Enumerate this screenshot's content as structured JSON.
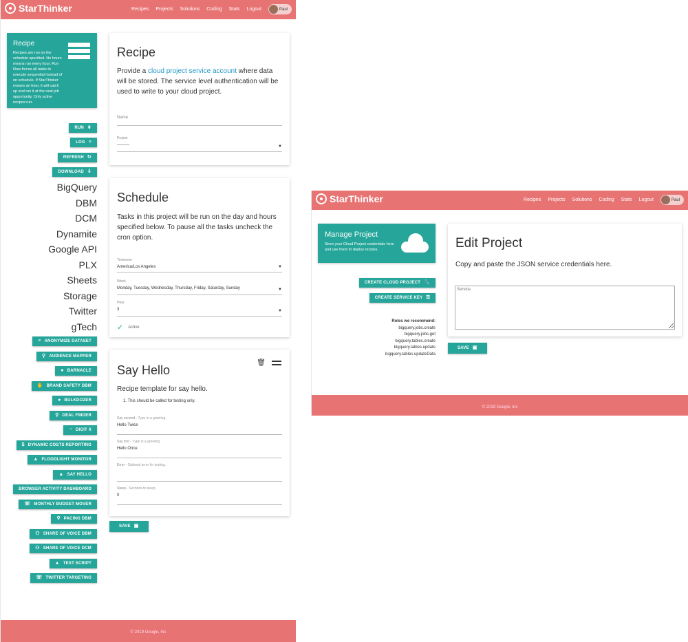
{
  "brand": "StarThinker",
  "nav": [
    "Recipes",
    "Projects",
    "Solutions",
    "Coding",
    "Stats",
    "Logout"
  ],
  "user": "Paul",
  "footer": "© 2019 Google, Inc",
  "recipe_page": {
    "info": {
      "title": "Recipe",
      "text": "Recipes are run on the schedule specified. No hours means run every hour. Run Now forces all tasks to execute sequential instead of on schedule. If StarThinker misses an hour, it will catch up and run it at the next job opportunity. Only active recipes run."
    },
    "actions": [
      {
        "label": "RUN",
        "icon": "⇟",
        "name": "run-button"
      },
      {
        "label": "LOG",
        "icon": "≡",
        "name": "log-button"
      },
      {
        "label": "REFRESH",
        "icon": "↻",
        "name": "refresh-button"
      },
      {
        "label": "DOWNLOAD",
        "icon": "⇩",
        "name": "download-button"
      }
    ],
    "sections": [
      "BigQuery",
      "DBM",
      "DCM",
      "Dynamite",
      "Google API",
      "PLX",
      "Sheets",
      "Storage",
      "Twitter",
      "gTech"
    ],
    "tasks": [
      {
        "label": "ANONYMIZE DATASET",
        "icon": "≡"
      },
      {
        "label": "AUDIENCE MAPPER",
        "icon": "⚲"
      },
      {
        "label": "BARNACLE",
        "icon": "●"
      },
      {
        "label": "BRAND SAFETY DBM",
        "icon": "✋"
      },
      {
        "label": "BULKDOZER",
        "icon": "●"
      },
      {
        "label": "DEAL FINDER",
        "icon": "⚲"
      },
      {
        "label": "DIGIT X",
        "icon": "◔"
      },
      {
        "label": "DYNAMIC COSTS REPORTING",
        "icon": "$"
      },
      {
        "label": "FLOODLIGHT MONITOR",
        "icon": "▲"
      },
      {
        "label": "SAY HELLO",
        "icon": "▲"
      },
      {
        "label": "BROWSER ACTIVITY DASHBOARD",
        "icon": ""
      },
      {
        "label": "MONTHLY BUDGET MOVER",
        "icon": "☏"
      },
      {
        "label": "PACING DBM",
        "icon": "⚲"
      },
      {
        "label": "SHARE OF VOICE DBM",
        "icon": "⚇"
      },
      {
        "label": "SHARE OF VOICE DCM",
        "icon": "⚇"
      },
      {
        "label": "TEST SCRIPT",
        "icon": "▲"
      },
      {
        "label": "TWITTER TARGETING",
        "icon": "☏"
      }
    ],
    "recipe_card": {
      "title": "Recipe",
      "lead_prefix": "Provide a ",
      "lead_link": "cloud project service account",
      "lead_suffix": " where data will be stored. The service level authentication will be used to write to your cloud project.",
      "name_label": "Name",
      "project_label": "Project",
      "project_value": "———"
    },
    "schedule_card": {
      "title": "Schedule",
      "lead": "Tasks in this project will be run on the day and hours specified below. To pause all the tasks uncheck the cron option.",
      "timezone_label": "Timezone",
      "timezone_value": "America/Los Angeles",
      "week_label": "Week",
      "week_value": "Monday, Tuesday, Wednesday, Thursday, Friday, Saturday, Sunday",
      "hour_label": "Hour",
      "hour_value": "3",
      "active_label": "Active"
    },
    "hello_card": {
      "title": "Say Hello",
      "lead": "Recipe template for say hello.",
      "step": "1. This should be called for testing only.",
      "fields": [
        {
          "label": "Say second",
          "hint": " - Type in a greeting.",
          "value": "Hello Twice"
        },
        {
          "label": "Say first",
          "hint": " - Type in a greeting.",
          "value": "Hello Once"
        },
        {
          "label": "Error",
          "hint": " - Optional error for testing.",
          "value": ""
        },
        {
          "label": "Sleep",
          "hint": " - Seconds to sleep.",
          "value": "0"
        }
      ]
    },
    "save_label": "SAVE"
  },
  "project_page": {
    "info": {
      "title": "Manage Project",
      "text": "Store your Cloud Project credentials here and use them to deploy recipes."
    },
    "actions": [
      {
        "label": "CREATE CLOUD PROJECT",
        "icon": "🔧"
      },
      {
        "label": "CREATE SERVICE KEY",
        "icon": "⚿"
      }
    ],
    "roles_title": "Roles we recommend:",
    "roles": [
      "bigquery.jobs.create",
      "bigquery.jobs.get",
      "bigquery.tables.create",
      "bigquery.tables.update",
      "bigquery.tables.updateData"
    ],
    "card": {
      "title": "Edit Project",
      "lead": "Copy and paste the JSON service credentials here.",
      "service_placeholder": "Service"
    },
    "save_label": "SAVE"
  }
}
